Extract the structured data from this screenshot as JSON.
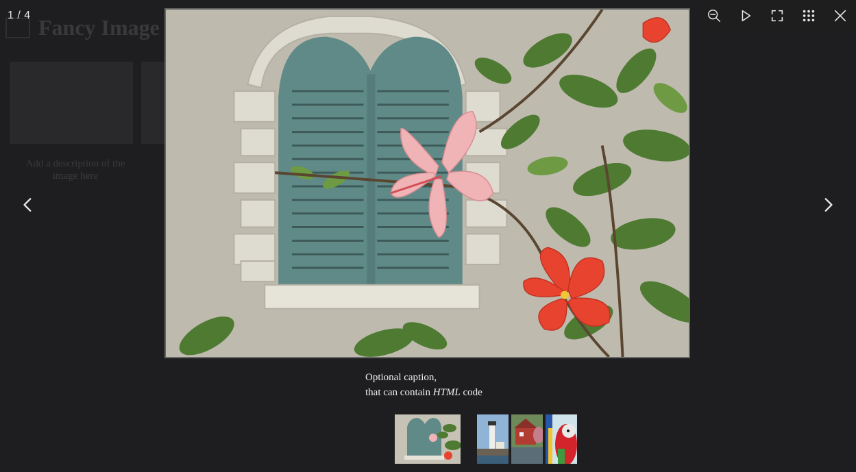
{
  "background": {
    "title": "Fancy Image",
    "description": "Add a description of the image here"
  },
  "viewer": {
    "counter": "1 / 4",
    "caption_line1": "Optional caption,",
    "caption_line2_prefix": "that can contain ",
    "caption_line2_em": "HTML",
    "caption_line2_suffix": " code"
  },
  "toolbar": {
    "items": [
      {
        "name": "zoom-out",
        "icon": "zoom-out-icon"
      },
      {
        "name": "slideshow",
        "icon": "play-icon"
      },
      {
        "name": "fullscreen",
        "icon": "fullscreen-icon"
      },
      {
        "name": "thumbnails",
        "icon": "grid-icon"
      },
      {
        "name": "close",
        "icon": "close-icon"
      }
    ]
  },
  "navigation": {
    "prev_icon": "chevron-left-icon",
    "next_icon": "chevron-right-icon"
  },
  "thumbnails": [
    {
      "subject": "window with hibiscus flowers",
      "active": true
    },
    {
      "subject": "lighthouse",
      "active": false
    },
    {
      "subject": "red mill building",
      "active": false
    },
    {
      "subject": "parrot",
      "active": false
    }
  ],
  "colors": {
    "overlay": "#1e1e20",
    "icon": "#e6e6e6",
    "wall": "#c9c5b8",
    "shutter": "#5f8a88",
    "hibiscus_red": "#e8432f",
    "hibiscus_pink": "#f0b4b6",
    "leaf": "#4f7a32"
  }
}
